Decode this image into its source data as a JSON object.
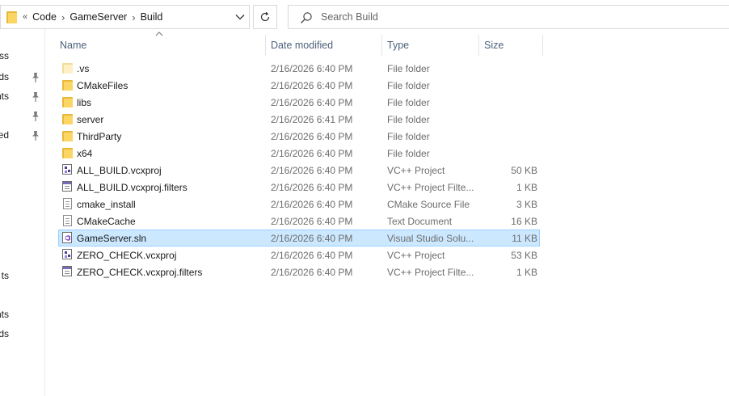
{
  "address_bar": {
    "overflow_glyph": "«",
    "crumbs": [
      "Code",
      "GameServer",
      "Build"
    ]
  },
  "search": {
    "placeholder": "Search Build"
  },
  "nav_pane": {
    "items": [
      {
        "label": "ss",
        "pinned": false
      },
      {
        "label": "ds",
        "pinned": true
      },
      {
        "label": "nts",
        "pinned": true
      },
      {
        "label": "",
        "pinned": true
      },
      {
        "label": "ed",
        "pinned": true
      },
      {
        "label": "ts",
        "pinned": false
      },
      {
        "label": "nts",
        "pinned": false
      },
      {
        "label": "ds",
        "pinned": false
      }
    ]
  },
  "columns": {
    "name": "Name",
    "date": "Date modified",
    "type": "Type",
    "size": "Size"
  },
  "files": [
    {
      "name": ".vs",
      "date": "2/16/2026 6:40 PM",
      "type": "File folder",
      "size": "",
      "icon": "folder-hidden-icon"
    },
    {
      "name": "CMakeFiles",
      "date": "2/16/2026 6:40 PM",
      "type": "File folder",
      "size": "",
      "icon": "folder-icon"
    },
    {
      "name": "libs",
      "date": "2/16/2026 6:40 PM",
      "type": "File folder",
      "size": "",
      "icon": "folder-icon"
    },
    {
      "name": "server",
      "date": "2/16/2026 6:41 PM",
      "type": "File folder",
      "size": "",
      "icon": "folder-icon"
    },
    {
      "name": "ThirdParty",
      "date": "2/16/2026 6:40 PM",
      "type": "File folder",
      "size": "",
      "icon": "folder-icon"
    },
    {
      "name": "x64",
      "date": "2/16/2026 6:40 PM",
      "type": "File folder",
      "size": "",
      "icon": "folder-icon"
    },
    {
      "name": "ALL_BUILD.vcxproj",
      "date": "2/16/2026 6:40 PM",
      "type": "VC++ Project",
      "size": "50 KB",
      "icon": "vcxproj-icon"
    },
    {
      "name": "ALL_BUILD.vcxproj.filters",
      "date": "2/16/2026 6:40 PM",
      "type": "VC++ Project Filte...",
      "size": "1 KB",
      "icon": "filters-icon"
    },
    {
      "name": "cmake_install",
      "date": "2/16/2026 6:40 PM",
      "type": "CMake Source File",
      "size": "3 KB",
      "icon": "document-icon"
    },
    {
      "name": "CMakeCache",
      "date": "2/16/2026 6:40 PM",
      "type": "Text Document",
      "size": "16 KB",
      "icon": "document-icon"
    },
    {
      "name": "GameServer.sln",
      "date": "2/16/2026 6:40 PM",
      "type": "Visual Studio Solu...",
      "size": "11 KB",
      "icon": "sln-icon",
      "selected": true
    },
    {
      "name": "ZERO_CHECK.vcxproj",
      "date": "2/16/2026 6:40 PM",
      "type": "VC++ Project",
      "size": "53 KB",
      "icon": "vcxproj-icon"
    },
    {
      "name": "ZERO_CHECK.vcxproj.filters",
      "date": "2/16/2026 6:40 PM",
      "type": "VC++ Project Filte...",
      "size": "1 KB",
      "icon": "filters-icon"
    }
  ],
  "colors": {
    "selection_bg": "#cce8ff",
    "selection_border": "#99d1ff",
    "header_text": "#4c607a",
    "folder": "#fcd664"
  }
}
